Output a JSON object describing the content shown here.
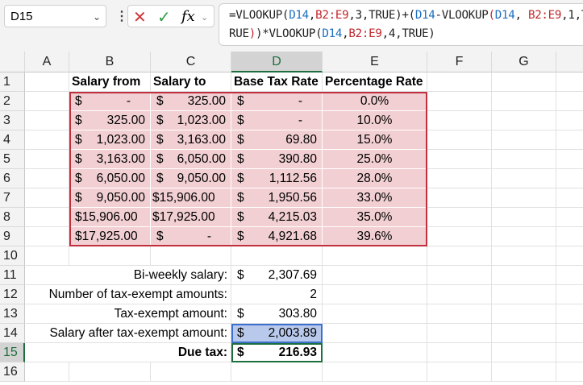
{
  "name_box": "D15",
  "formula_segments": [
    {
      "t": "=VLOOKUP(",
      "c": "#222"
    },
    {
      "t": "D14",
      "c": "#1f6fbf"
    },
    {
      "t": ",",
      "c": "#222"
    },
    {
      "t": "B2:E9",
      "c": "#c0282d"
    },
    {
      "t": ",3,TRUE)+(",
      "c": "#222"
    },
    {
      "t": "D14",
      "c": "#1f6fbf"
    },
    {
      "t": "-VLOOKUP",
      "c": "#222"
    },
    {
      "t": "(",
      "c": "#c0282d"
    },
    {
      "t": "D14",
      "c": "#1f6fbf"
    },
    {
      "t": ", ",
      "c": "#222"
    },
    {
      "t": "B2:E9",
      "c": "#c0282d"
    },
    {
      "t": ",1,TRUE",
      "c": "#222"
    },
    {
      "t": ")",
      "c": "#c0282d"
    },
    {
      "t": ")*VLOOKUP(",
      "c": "#222"
    },
    {
      "t": "D14",
      "c": "#1f6fbf"
    },
    {
      "t": ",",
      "c": "#222"
    },
    {
      "t": "B2:E9",
      "c": "#c0282d"
    },
    {
      "t": ",4,TRUE)",
      "c": "#222"
    }
  ],
  "columns": [
    "A",
    "B",
    "C",
    "D",
    "E",
    "F",
    "G"
  ],
  "rows": [
    "1",
    "2",
    "3",
    "4",
    "5",
    "6",
    "7",
    "8",
    "9",
    "10",
    "11",
    "12",
    "13",
    "14",
    "15",
    "16"
  ],
  "headers": [
    "Salary from",
    "Salary to",
    "Base Tax Rate",
    "Percentage Rate"
  ],
  "table": [
    [
      "$",
      "-",
      "$",
      "325.00",
      "$",
      "-",
      "0.0%"
    ],
    [
      "$",
      "325.00",
      "$",
      "1,023.00",
      "$",
      "-",
      "10.0%"
    ],
    [
      "$",
      "1,023.00",
      "$",
      "3,163.00",
      "$",
      "69.80",
      "15.0%"
    ],
    [
      "$",
      "3,163.00",
      "$",
      "6,050.00",
      "$",
      "390.80",
      "25.0%"
    ],
    [
      "$",
      "6,050.00",
      "$",
      "9,050.00",
      "$",
      "1,112.56",
      "28.0%"
    ],
    [
      "$",
      "9,050.00",
      "$15,906.00",
      "",
      "$",
      "1,950.56",
      "33.0%"
    ],
    [
      "$15,906.00",
      "",
      "$17,925.00",
      "",
      "$",
      "4,215.03",
      "35.0%"
    ],
    [
      "$17,925.00",
      "",
      "$",
      "-",
      "$",
      "4,921.68",
      "39.6%"
    ]
  ],
  "summary": [
    {
      "label": "Bi-weekly salary:",
      "cur": "$",
      "value": "2,307.69"
    },
    {
      "label": "Number of tax-exempt amounts:",
      "cur": "",
      "value": "2"
    },
    {
      "label": "Tax-exempt amount:",
      "cur": "$",
      "value": "303.80"
    },
    {
      "label": "Salary after tax-exempt amount:",
      "cur": "$",
      "value": "2,003.89"
    },
    {
      "label": "Due tax:",
      "cur": "$",
      "value": "216.93"
    }
  ],
  "colors": {
    "range_fill": "#f2cfd2",
    "range_border": "#c0303f",
    "ref_fill": "#b9c9ec",
    "ref_border": "#3b6fd0",
    "active_border": "#1e6e3e"
  }
}
